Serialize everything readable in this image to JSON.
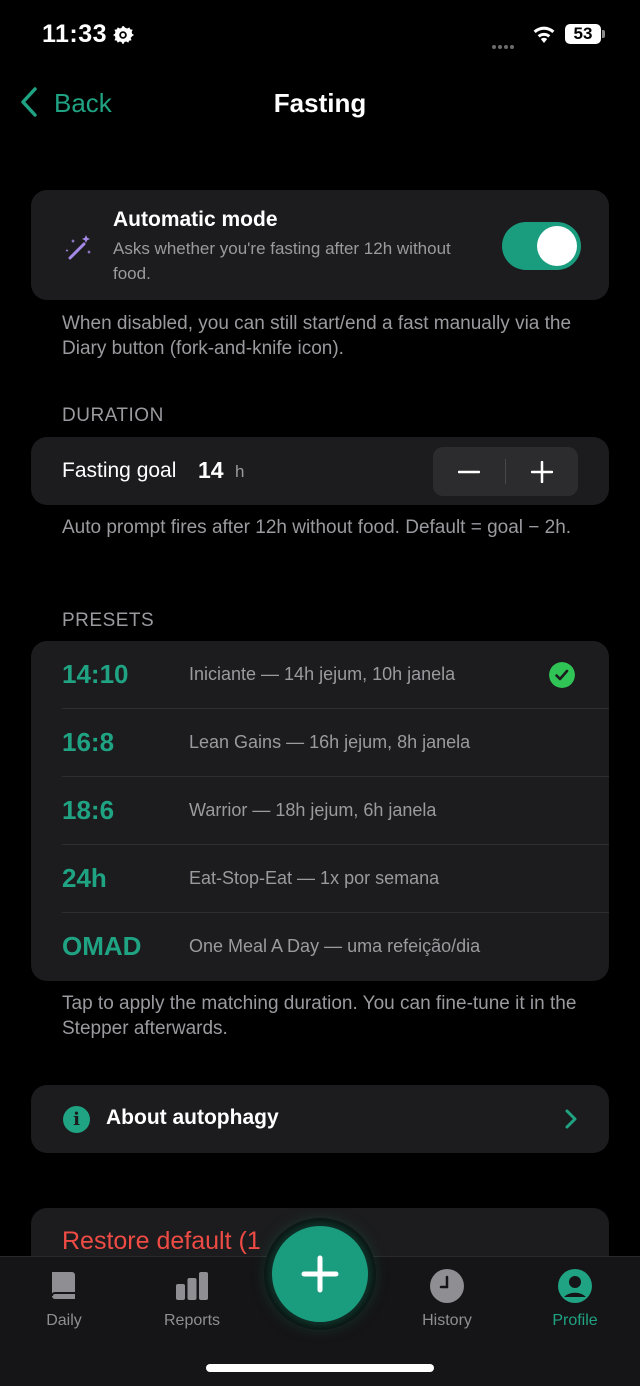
{
  "status_bar": {
    "time": "11:33",
    "battery": "53"
  },
  "nav": {
    "back_label": "Back",
    "title": "Fasting"
  },
  "automatic_mode": {
    "title": "Automatic mode",
    "subtitle": "Asks whether you're fasting after 12h without food.",
    "enabled": true,
    "note": "When disabled, you can still start/end a fast manually via the Diary button (fork-and-knife icon)."
  },
  "duration": {
    "header": "DURATION",
    "goal_label": "Fasting goal",
    "goal_value": "14",
    "goal_unit": "h",
    "minus": "−",
    "plus": "+",
    "note": "Auto prompt fires after 12h without food. Default = goal − 2h."
  },
  "presets": {
    "header": "PRESETS",
    "items": [
      {
        "code": "14:10",
        "desc": "Iniciante — 14h jejum, 10h janela",
        "selected": true
      },
      {
        "code": "16:8",
        "desc": "Lean Gains — 16h jejum, 8h janela",
        "selected": false
      },
      {
        "code": "18:6",
        "desc": "Warrior — 18h jejum, 6h janela",
        "selected": false
      },
      {
        "code": "24h",
        "desc": "Eat-Stop-Eat — 1x por semana",
        "selected": false
      },
      {
        "code": "OMAD",
        "desc": "One Meal A Day — uma refeição/dia",
        "selected": false
      }
    ],
    "note": "Tap to apply the matching duration. You can fine-tune it in the Stepper afterwards."
  },
  "about": {
    "label": "About autophagy",
    "icon": "info-icon"
  },
  "restore": {
    "label": "Restore default (1"
  },
  "tabbar": {
    "daily": "Daily",
    "reports": "Reports",
    "history": "History",
    "profile": "Profile",
    "active": "profile"
  },
  "colors": {
    "accent": "#1fa383",
    "toggle_on": "#1a9c7e",
    "destructive": "#ee4b45",
    "check": "#30c356"
  }
}
